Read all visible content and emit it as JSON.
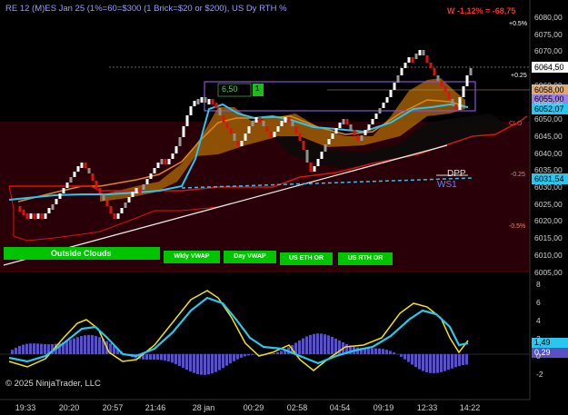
{
  "header": {
    "title": "RE 12 (M)ES Jan 25 (1%=60=$300  (1 Brick=$20 or $200), US Dy RTH %",
    "pnl": "W -1,12% = -68,75"
  },
  "footer": {
    "copyright": "© 2025 NinjaTrader, LLC"
  },
  "buttons": {
    "outside_clouds": "Outside Clouds",
    "wkly_vwap": "Wkly VWAP",
    "day_vwap": "Day VWAP",
    "us_eth_or": "US ETH OR",
    "us_rth_or": "US RTH OR"
  },
  "box_label": {
    "value": "6,50",
    "count": "1"
  },
  "price_axis": [
    "6080,00",
    "6075,00",
    "6070,00",
    "6065,00",
    "6060,00",
    "6055,00",
    "6050,00",
    "6045,00",
    "6040,00",
    "6035,00",
    "6030,00",
    "6025,00",
    "6020,00",
    "6015,00",
    "6010,00",
    "6005,00"
  ],
  "price_tags": {
    "last": "6064,50",
    "box_top": "6058,00",
    "box_mid": "6055,00",
    "cyan": "6052,07",
    "wvwap": "6031,54"
  },
  "percent_labels": {
    "p05": "+0.5%",
    "p025": "+0.25",
    "clo": "CLO",
    "m025": "-0.25",
    "m05": "-0.5%"
  },
  "level_labels": {
    "dpp": "DPP",
    "ws1": "WS1"
  },
  "osc_axis": [
    "8",
    "6",
    "4",
    "2",
    "0",
    "-2"
  ],
  "osc_tags": {
    "fast": "1,49",
    "hist": "0,29"
  },
  "time_axis": [
    "19:33",
    "20:20",
    "20:57",
    "21:46",
    "28 jan",
    "00:29",
    "02:58",
    "04:54",
    "09:19",
    "12:33",
    "14:22"
  ],
  "colors": {
    "bull": "#ffffff",
    "bear": "#e01010",
    "cloud": "#c8780a",
    "cyan": "#27c7f0",
    "osc_yellow": "#f5e300",
    "hist": "#5b4fc4"
  }
}
